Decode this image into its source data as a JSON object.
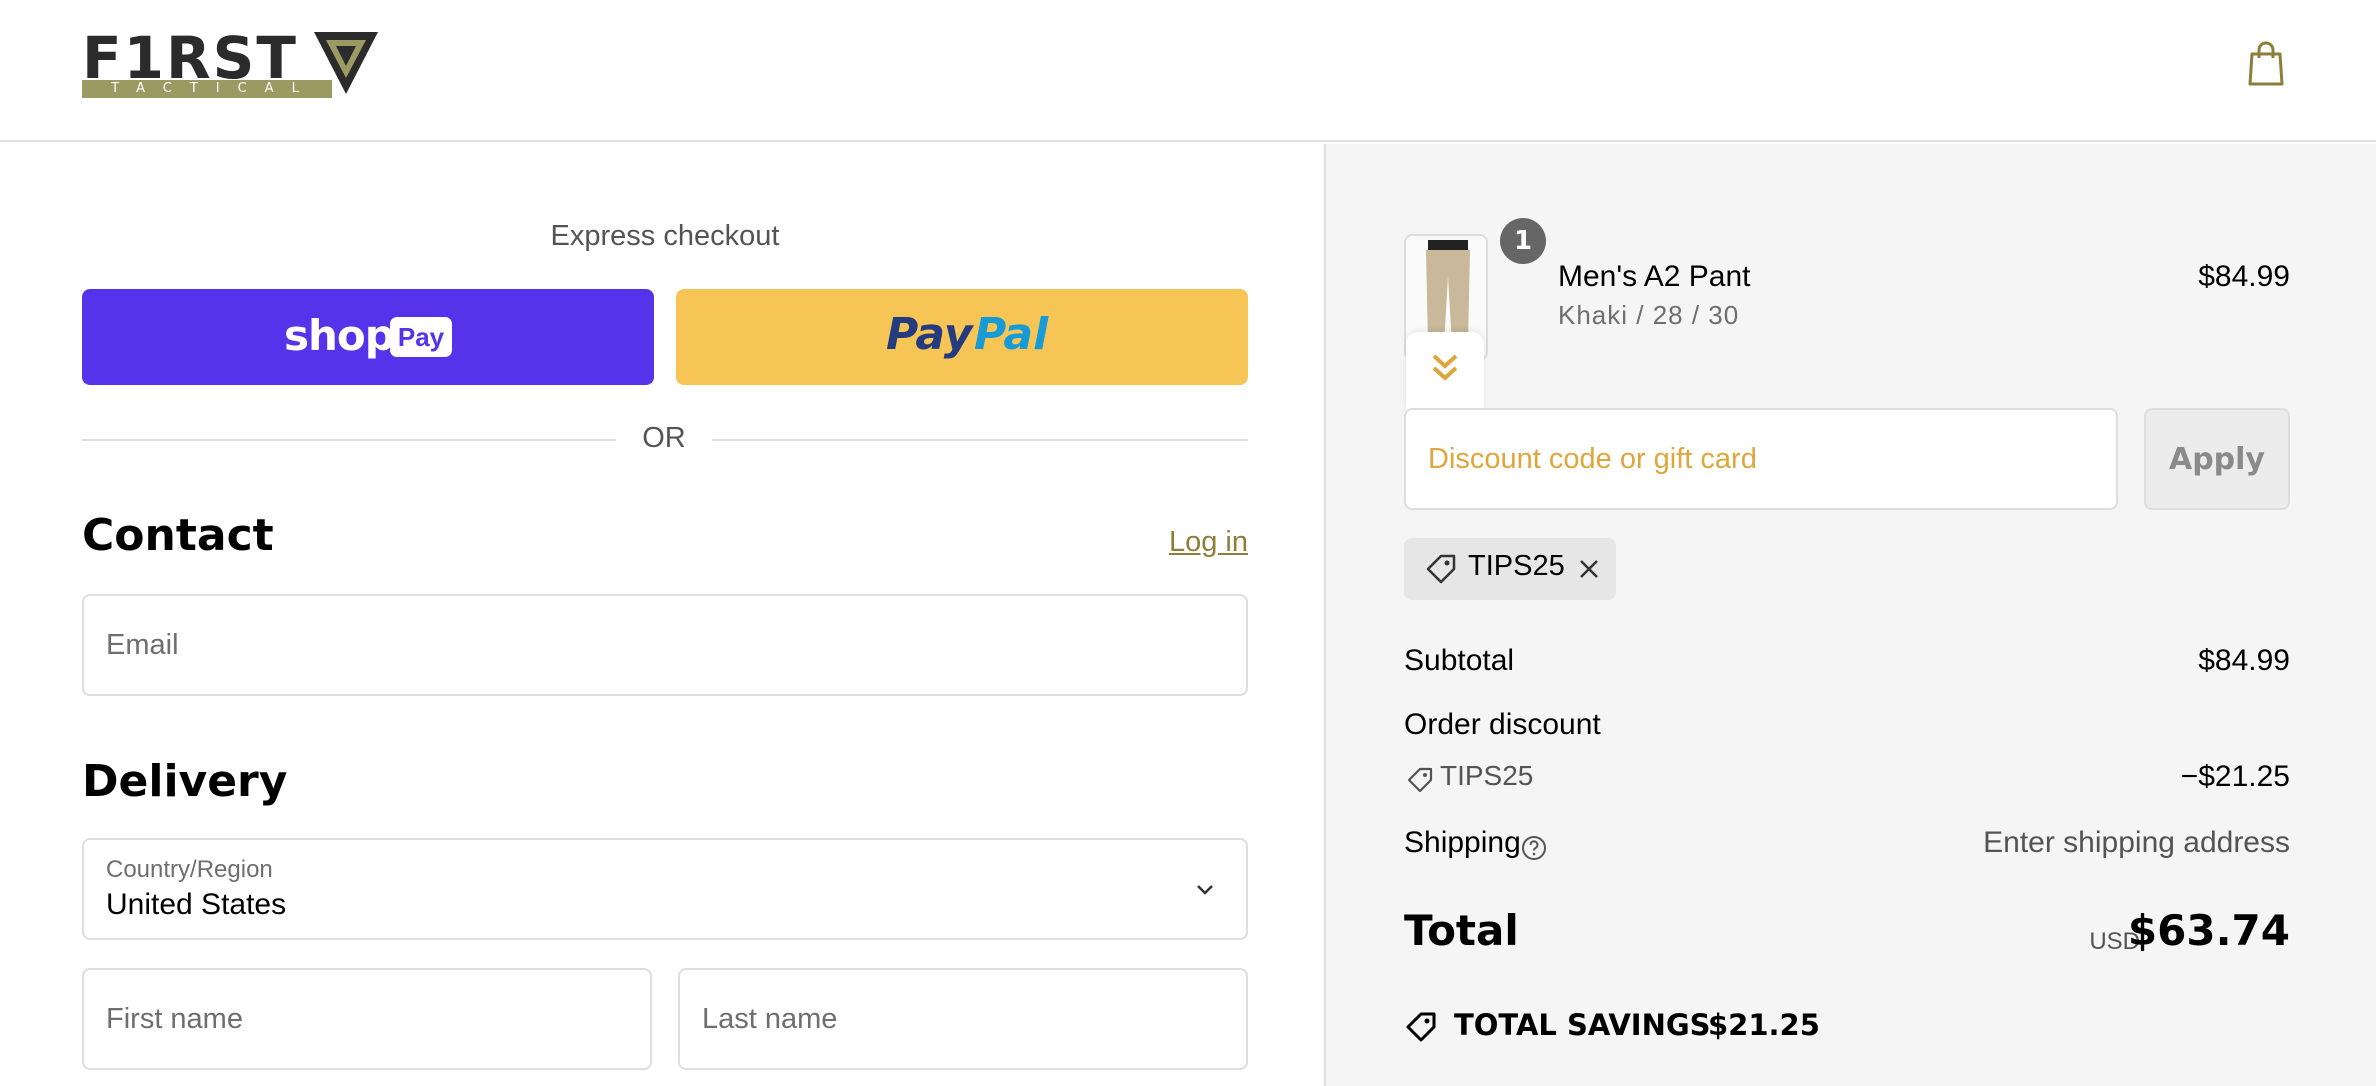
{
  "header": {
    "logo_text": "F1RST",
    "logo_subtext": "TACTICAL",
    "bag_icon": "shopping-bag-icon"
  },
  "express": {
    "title": "Express checkout",
    "shop_pay_word": "shop",
    "shop_pay_badge": "Pay",
    "paypal_pay": "Pay",
    "paypal_pal": "Pal",
    "divider": "OR"
  },
  "contact": {
    "title": "Contact",
    "login_link": "Log in",
    "email_placeholder": "Email"
  },
  "delivery": {
    "title": "Delivery",
    "country_label": "Country/Region",
    "country_value": "United States",
    "first_name_placeholder": "First name",
    "last_name_placeholder": "Last name"
  },
  "cart": {
    "item": {
      "name": "Men's A2 Pant",
      "variant": "Khaki / 28 / 30",
      "price": "$84.99",
      "quantity": "1"
    },
    "discount_placeholder": "Discount code or gift card",
    "apply_label": "Apply",
    "applied_code": "TIPS25",
    "subtotal_label": "Subtotal",
    "subtotal_value": "$84.99",
    "order_discount_label": "Order discount",
    "order_discount_code": "TIPS25",
    "order_discount_value": "−$21.25",
    "shipping_label": "Shipping",
    "shipping_value": "Enter shipping address",
    "total_label": "Total",
    "total_currency": "USD",
    "total_value": "$63.74",
    "savings_label": "TOTAL SAVINGS",
    "savings_value": "$21.25"
  },
  "colors": {
    "shop_pay": "#5433eb",
    "paypal": "#f6c555",
    "link": "#8d7e3b",
    "discount_placeholder": "#e0a63c",
    "sidebar_bg": "#f5f5f5"
  }
}
